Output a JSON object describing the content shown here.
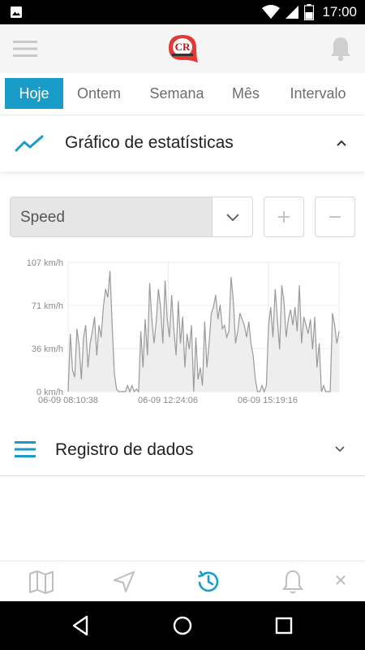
{
  "status_bar": {
    "time": "17:00"
  },
  "header": {
    "logo_text": "CR"
  },
  "tabs": [
    {
      "label": "Hoje",
      "active": true
    },
    {
      "label": "Ontem",
      "active": false
    },
    {
      "label": "Semana",
      "active": false
    },
    {
      "label": "Mês",
      "active": false
    },
    {
      "label": "Intervalo",
      "active": false
    }
  ],
  "stats_card": {
    "title": "Gráfico de estatísticas"
  },
  "metric_select": {
    "value": "Speed",
    "zoom_in": "+",
    "zoom_out": "−"
  },
  "chart_data": {
    "type": "area",
    "series": [
      {
        "values": [
          0,
          48,
          18,
          12,
          52,
          38,
          10,
          45,
          55,
          20,
          40,
          50,
          62,
          30,
          55,
          45,
          70,
          85,
          78,
          100,
          55,
          15,
          2,
          0,
          0,
          0,
          0,
          5,
          0,
          5,
          0,
          2,
          0,
          50,
          20,
          60,
          30,
          90,
          60,
          40,
          58,
          85,
          70,
          40,
          92,
          60,
          45,
          80,
          52,
          30,
          75,
          40,
          62,
          20,
          48,
          35,
          55,
          0,
          45,
          10,
          20,
          5,
          58,
          20,
          40,
          65,
          70,
          80,
          60,
          72,
          52,
          55,
          45,
          50,
          95,
          75,
          40,
          50,
          65,
          60,
          55,
          45,
          58,
          40,
          30,
          10,
          0,
          0,
          5,
          0,
          5,
          55,
          70,
          45,
          85,
          60,
          35,
          88,
          75,
          45,
          60,
          68,
          55,
          70,
          50,
          88,
          40,
          62,
          55,
          48,
          60,
          35,
          62,
          20,
          40,
          0,
          5,
          0,
          0,
          0,
          65,
          55,
          40,
          50
        ]
      }
    ],
    "ylim": [
      0,
      107
    ],
    "y_ticks": [
      "107 km/h",
      "71 km/h",
      "36 km/h",
      "0 km/h"
    ],
    "x_ticks": [
      "06-09 08:10:38",
      "06-09 12:24:06",
      "06-09 15:19:16"
    ],
    "grid": true
  },
  "log_card": {
    "title": "Registro de dados"
  },
  "colors": {
    "accent": "#1a9cc9",
    "chart_line": "#9a9a9a",
    "chart_fill": "#eeeeee"
  }
}
